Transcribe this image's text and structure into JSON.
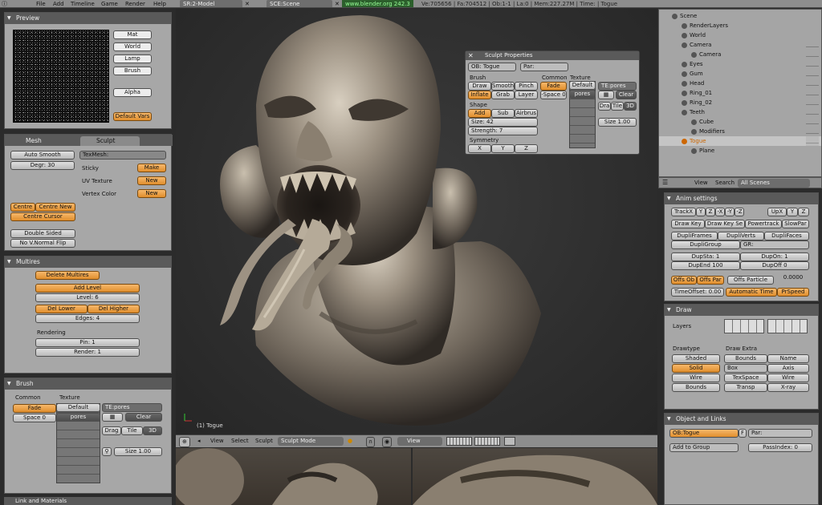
{
  "topbar": {
    "menus": [
      "File",
      "Add",
      "Timeline",
      "Game",
      "Render",
      "Help"
    ],
    "screen": "SR:2-Model",
    "scene": "SCE:Scene",
    "url": "www.blender.org 242.3",
    "stats": "Ve:705656 | Fa:704512 | Ob:1-1 | La:0 | Mem:227.27M | Time: | Togue"
  },
  "preview": {
    "header": "Preview",
    "buttons": [
      "Mat",
      "World",
      "Lamp",
      "Brush"
    ],
    "alpha": "Alpha",
    "default_vars": "Default Vars"
  },
  "mesh": {
    "tab_mesh": "Mesh",
    "tab_sculpt": "Sculpt",
    "auto_smooth": "Auto Smooth",
    "degr": "Degr: 30",
    "texmesh": "TexMesh:",
    "sticky": "Sticky",
    "make": "Make",
    "uv_texture": "UV Texture",
    "new1": "New",
    "vertex_color": "Vertex Color",
    "new2": "New",
    "centre": "Centre",
    "centre_new": "Centre New",
    "centre_cursor": "Centre Cursor",
    "double_sided": "Double Sided",
    "no_vnormal_flip": "No V.Normal Flip"
  },
  "multires": {
    "header": "Multires",
    "delete": "Delete Multires",
    "add_level": "Add Level",
    "level": "Level: 6",
    "del_lower": "Del Lower",
    "del_higher": "Del Higher",
    "edges": "Edges: 4",
    "rendering": "Rendering",
    "pin": "Pin: 1",
    "render": "Render: 1"
  },
  "brush": {
    "header": "Brush",
    "common": "Common",
    "texture": "Texture",
    "fade": "Fade",
    "space": "Space 0",
    "default": "Default",
    "pores": "pores",
    "te_pores": "TE:pores",
    "clear": "Clear",
    "drag": "Drag",
    "tile": "Tile",
    "three_d": "3D",
    "size": "Size 1.00"
  },
  "link_header": "Link and Materials",
  "sculpt_props": {
    "title": "Sculpt Properties",
    "ob": "OB: Togue",
    "par": "Par:",
    "brush_label": "Brush",
    "common_label": "Common",
    "texture_label": "Texture",
    "draw": "Draw",
    "smooth": "Smooth",
    "pinch": "Pinch",
    "inflate": "Inflate",
    "grab": "Grab",
    "layer": "Layer",
    "fade": "Fade",
    "space": "-Space 0",
    "default": "Default",
    "pores": "pores",
    "te_pores": "TE:pores",
    "clear": "Clear",
    "shape": "Shape",
    "add": "Add",
    "sub": "Sub",
    "airbrush": "Airbrus",
    "size": "Size: 42",
    "strength": "Strength: 7",
    "symmetry": "Symmetry",
    "x": "X",
    "y": "Y",
    "z": "Z",
    "drag": "Dra",
    "tile": "Tile",
    "three_d": "3D",
    "size2": "Size 1.00"
  },
  "viewport": {
    "label": "(1) Togue"
  },
  "viewbar": {
    "view": "View",
    "select": "Select",
    "sculpt": "Sculpt",
    "mode": "Sculpt Mode",
    "view2": "View"
  },
  "outliner": {
    "items": [
      "Scene",
      "RenderLayers",
      "World",
      "Camera",
      "Camera",
      "Eyes",
      "Gum",
      "Head",
      "Ring_01",
      "Ring_02",
      "Teeth",
      "Cube",
      "Modifiers",
      "Togue",
      "Plane"
    ],
    "view": "View",
    "search": "Search",
    "all_scenes": "All Scenes"
  },
  "anim": {
    "header": "Anim settings",
    "trackx": "TrackX",
    "axes": [
      "Y",
      "Z",
      "-X",
      "-Y",
      "-Z"
    ],
    "upx": "UpX",
    "upy": "Y",
    "upz": "Z",
    "draw_key": "Draw Key",
    "draw_key_sel": "Draw Key Se",
    "powertrack": "Powertrack",
    "slowpar": "SlowPar",
    "dupliframes": "DupliFrames",
    "dupliverts": "DupliVerts",
    "duplifaces": "DupliFaces",
    "dupligroup": "DupliGroup",
    "gr": "GR:",
    "dupsta": "DupSta: 1",
    "dupon": "DupOn: 1",
    "dupend": "DupEnd 100",
    "dupoff": "DupOff 0",
    "offs_ob": "Offs Ob",
    "offs_par": "Offs Par",
    "offs_particle": "Offs Particle",
    "offs_value": "0.0000",
    "timeoffset": "TimeOffset: 0.00",
    "automatic_time": "Automatic Time",
    "prspeed": "PrSpeed"
  },
  "draw": {
    "header": "Draw",
    "layers": "Layers",
    "drawtype": "Drawtype",
    "draw_extra": "Draw Extra",
    "shaded": "Shaded",
    "solid": "Solid",
    "wire": "Wire",
    "bounds": "Bounds",
    "bounds2": "Bounds",
    "name": "Name",
    "box": "Box",
    "axis": "Axis",
    "texspace": "TexSpace",
    "wire2": "Wire",
    "transp": "Transp",
    "xray": "X-ray"
  },
  "objlinks": {
    "header": "Object and Links",
    "ob": "OB:Togue",
    "f": "F",
    "par": "Par:",
    "add_to_group": "Add to Group",
    "passindex": "PassIndex: 0"
  }
}
